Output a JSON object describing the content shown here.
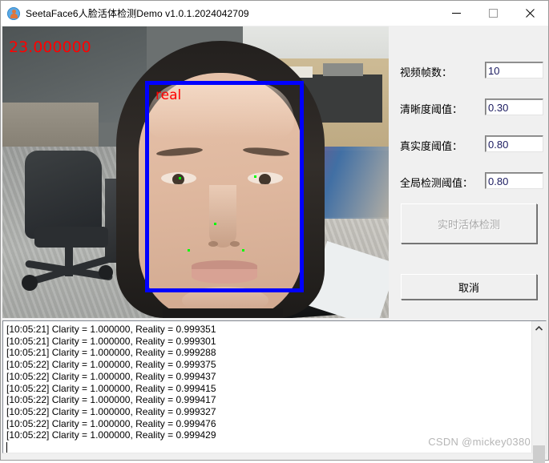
{
  "window": {
    "title": "SeetaFace6人脸活体检测Demo v1.0.1.2024042709",
    "icon": "person-badge-icon",
    "controls": {
      "minimize": "minimize-icon",
      "maximize": "maximize-icon",
      "close": "close-icon"
    }
  },
  "video": {
    "fps_overlay": "23.000000",
    "face_label": "real",
    "box_color": "#0000ff",
    "label_color": "#ff0000",
    "landmark_color": "#00ff00"
  },
  "settings": {
    "fields": [
      {
        "label": "视频帧数：",
        "value": "10"
      },
      {
        "label": "清晰度阈值：",
        "value": "0.30"
      },
      {
        "label": "真实度阈值：",
        "value": "0.80"
      },
      {
        "label": "全局检测阈值：",
        "value": "0.80"
      }
    ],
    "buttons": {
      "detect": "实时活体检测",
      "cancel": "取消"
    }
  },
  "log": {
    "lines": [
      "[10:05:21] Clarity = 1.000000, Reality = 0.999351",
      "[10:05:21] Clarity = 1.000000, Reality = 0.999301",
      "[10:05:21] Clarity = 1.000000, Reality = 0.999288",
      "[10:05:22] Clarity = 1.000000, Reality = 0.999375",
      "[10:05:22] Clarity = 1.000000, Reality = 0.999437",
      "[10:05:22] Clarity = 1.000000, Reality = 0.999415",
      "[10:05:22] Clarity = 1.000000, Reality = 0.999417",
      "[10:05:22] Clarity = 1.000000, Reality = 0.999327",
      "[10:05:22] Clarity = 1.000000, Reality = 0.999476",
      "[10:05:22] Clarity = 1.000000, Reality = 0.999429"
    ]
  },
  "watermark": "CSDN @mickey0380"
}
